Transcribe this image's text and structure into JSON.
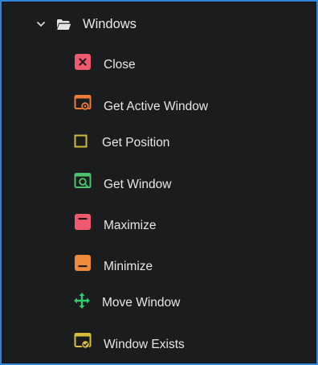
{
  "tree": {
    "group": {
      "label": "Windows",
      "chevron_icon": "chevron-down-icon",
      "folder_icon": "folder-open-icon"
    },
    "items": [
      {
        "label": "Close",
        "icon": "close-window-icon",
        "color": "#ef5a6f"
      },
      {
        "label": "Get Active Window",
        "icon": "active-window-icon",
        "color": "#ee7d3a"
      },
      {
        "label": "Get Position",
        "icon": "position-square-icon",
        "color": "#d2b93c"
      },
      {
        "label": "Get Window",
        "icon": "window-search-icon",
        "color": "#4cc26c"
      },
      {
        "label": "Maximize",
        "icon": "maximize-icon",
        "color": "#ef5a6f"
      },
      {
        "label": "Minimize",
        "icon": "minimize-icon",
        "color": "#ee8a3a"
      },
      {
        "label": "Move Window",
        "icon": "move-arrows-icon",
        "color": "#35c96e"
      },
      {
        "label": "Window Exists",
        "icon": "window-check-icon",
        "color": "#d9bd3c"
      }
    ]
  }
}
